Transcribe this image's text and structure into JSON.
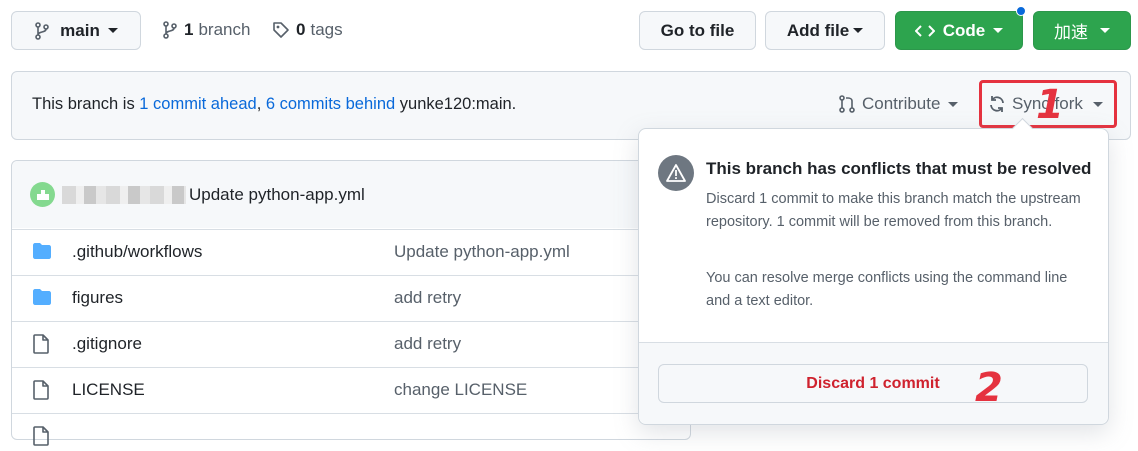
{
  "toolbar": {
    "branch_label": "main",
    "branches_count": "1",
    "branches_label": "branch",
    "tags_count": "0",
    "tags_label": "tags",
    "go_to_file": "Go to file",
    "add_file": "Add file",
    "code": "Code",
    "accelerate": "加速"
  },
  "banner": {
    "prefix": "This branch is ",
    "ahead_link": "1 commit ahead",
    "sep": ", ",
    "behind_link": "6 commits behind",
    "suffix": " yunke120:main.",
    "contribute": "Contribute",
    "sync_fork": "Sync fork"
  },
  "latest_commit": {
    "message": "Update python-app.yml"
  },
  "files": [
    {
      "name": ".github/workflows",
      "message": "Update python-app.yml",
      "type": "folder"
    },
    {
      "name": "figures",
      "message": "add retry",
      "type": "folder"
    },
    {
      "name": ".gitignore",
      "message": "add retry",
      "type": "file"
    },
    {
      "name": "LICENSE",
      "message": "change LICENSE",
      "type": "file"
    }
  ],
  "popup": {
    "title": "This branch has conflicts that must be resolved",
    "body1": "Discard 1 commit to make this branch match the upstream repository. 1 commit will be removed from this branch.",
    "body2": "You can resolve merge conflicts using the command line and a text editor.",
    "discard_button": "Discard 1 commit"
  },
  "annotations": {
    "one": "1",
    "two": "2"
  },
  "colors": {
    "accent_green": "#2da44e",
    "link_blue": "#0969da",
    "danger_red": "#cf222e",
    "annotation_red": "#e5323f"
  }
}
